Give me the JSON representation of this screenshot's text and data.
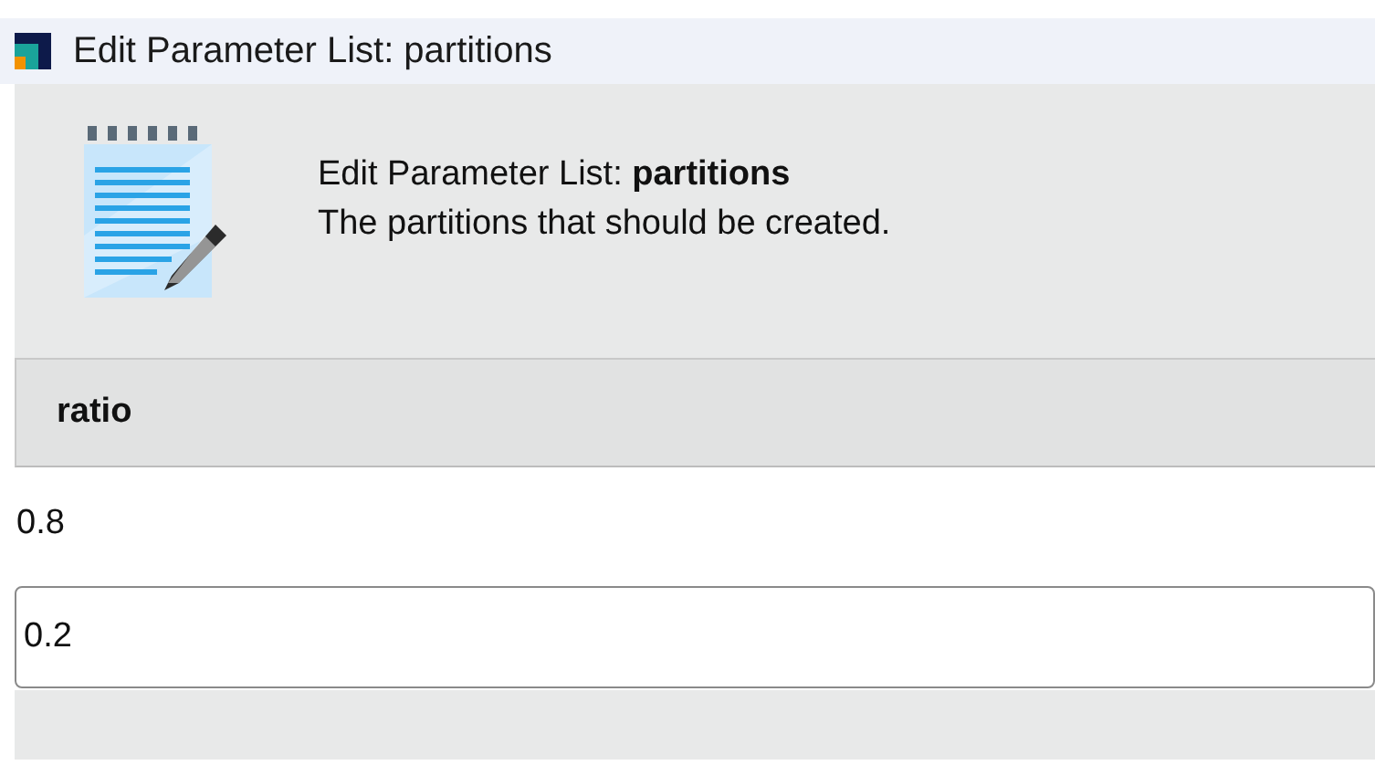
{
  "window": {
    "title": "Edit Parameter List: partitions"
  },
  "header": {
    "title": "Edit Parameter List: **partitions**",
    "description": "The partitions that should be created."
  },
  "table": {
    "columns": [
      "ratio"
    ],
    "rows": [
      {
        "cells": [
          "0.8"
        ],
        "editing": false
      },
      {
        "cells": [
          "0.2"
        ],
        "editing": true
      }
    ]
  }
}
